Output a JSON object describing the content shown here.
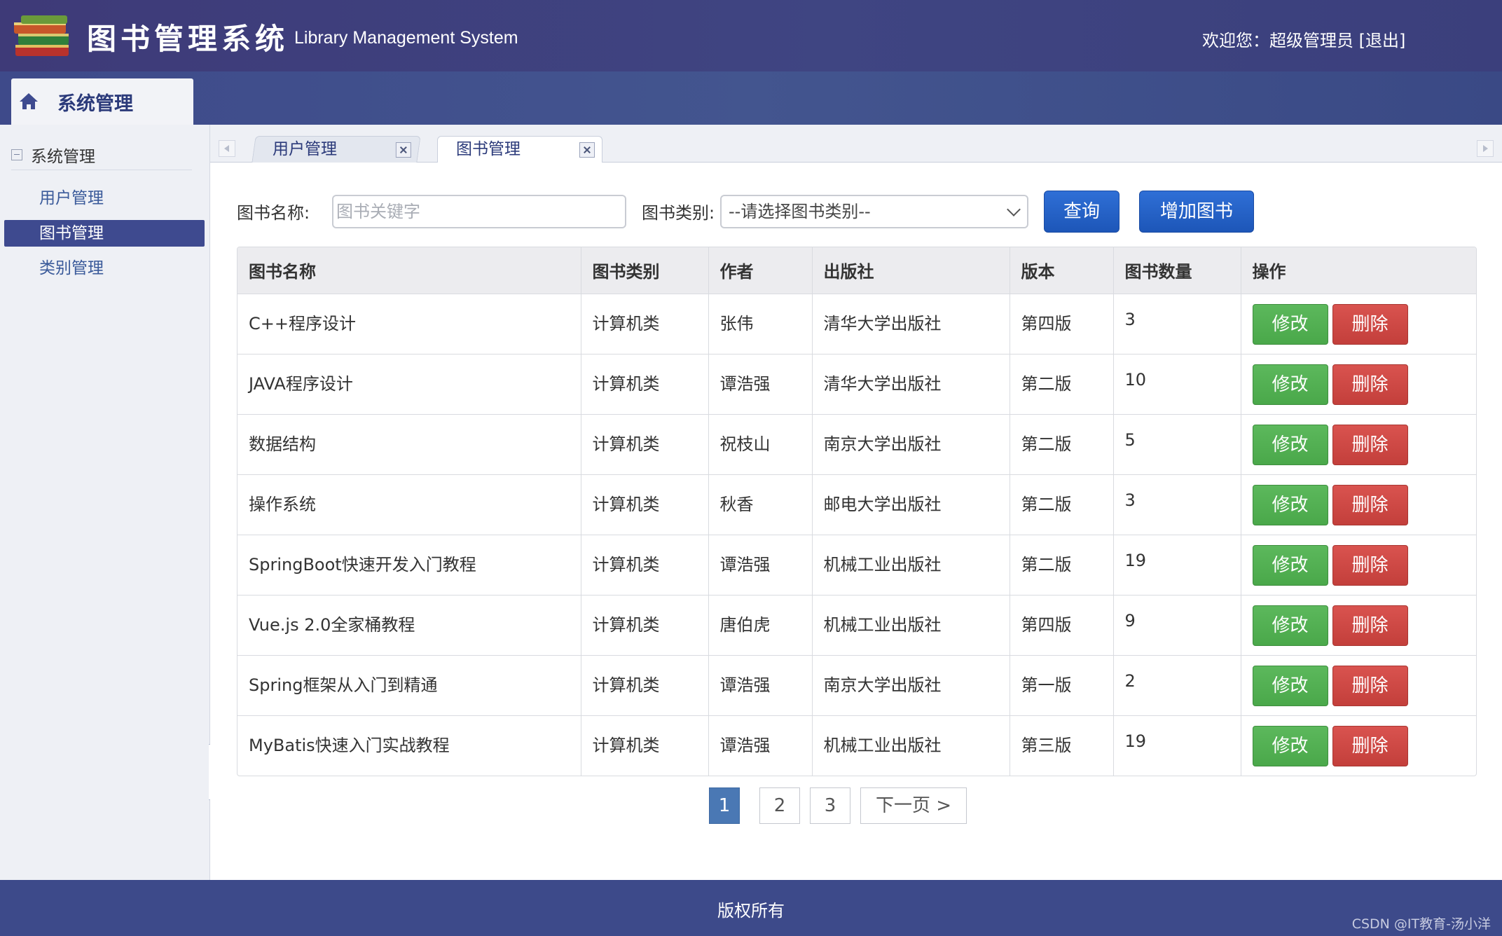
{
  "header": {
    "title": "图书管理系统",
    "subtitle": "Library Management System",
    "welcome": "欢迎您：超级管理员",
    "logout": "[退出]"
  },
  "nav": {
    "tab_label": "系统管理"
  },
  "sidebar": {
    "group": "系统管理",
    "items": [
      {
        "label": "用户管理"
      },
      {
        "label": "图书管理"
      },
      {
        "label": "类别管理"
      }
    ]
  },
  "tabs": [
    {
      "label": "用户管理"
    },
    {
      "label": "图书管理"
    }
  ],
  "search": {
    "name_label": "图书名称:",
    "name_placeholder": "图书关键字",
    "category_label": "图书类别:",
    "category_selected": "--请选择图书类别--",
    "query_button": "查询",
    "add_button": "增加图书"
  },
  "table": {
    "headers": [
      "图书名称",
      "图书类别",
      "作者",
      "出版社",
      "版本",
      "图书数量",
      "操作"
    ],
    "edit_label": "修改",
    "delete_label": "删除",
    "rows": [
      [
        "C++程序设计",
        "计算机类",
        "张伟",
        "清华大学出版社",
        "第四版",
        "3"
      ],
      [
        "JAVA程序设计",
        "计算机类",
        "谭浩强",
        "清华大学出版社",
        "第二版",
        "10"
      ],
      [
        "数据结构",
        "计算机类",
        "祝枝山",
        "南京大学出版社",
        "第二版",
        "5"
      ],
      [
        "操作系统",
        "计算机类",
        "秋香",
        "邮电大学出版社",
        "第二版",
        "3"
      ],
      [
        "SpringBoot快速开发入门教程",
        "计算机类",
        "谭浩强",
        "机械工业出版社",
        "第二版",
        "19"
      ],
      [
        "Vue.js 2.0全家桶教程",
        "计算机类",
        "唐伯虎",
        "机械工业出版社",
        "第四版",
        "9"
      ],
      [
        "Spring框架从入门到精通",
        "计算机类",
        "谭浩强",
        "南京大学出版社",
        "第一版",
        "2"
      ],
      [
        "MyBatis快速入门实战教程",
        "计算机类",
        "谭浩强",
        "机械工业出版社",
        "第三版",
        "19"
      ]
    ]
  },
  "pagination": {
    "pages": [
      "1",
      "2",
      "3"
    ],
    "current": "1",
    "next_label": "下一页 >"
  },
  "footer": {
    "copyright": "版权所有",
    "watermark": "CSDN @IT教育-汤小洋"
  },
  "colors": {
    "header_bg": "#3e3a78",
    "primary_blue": "#2f6fd6",
    "edit_green": "#5cb85c",
    "delete_red": "#d9534f",
    "active_page": "#4a78b4"
  }
}
